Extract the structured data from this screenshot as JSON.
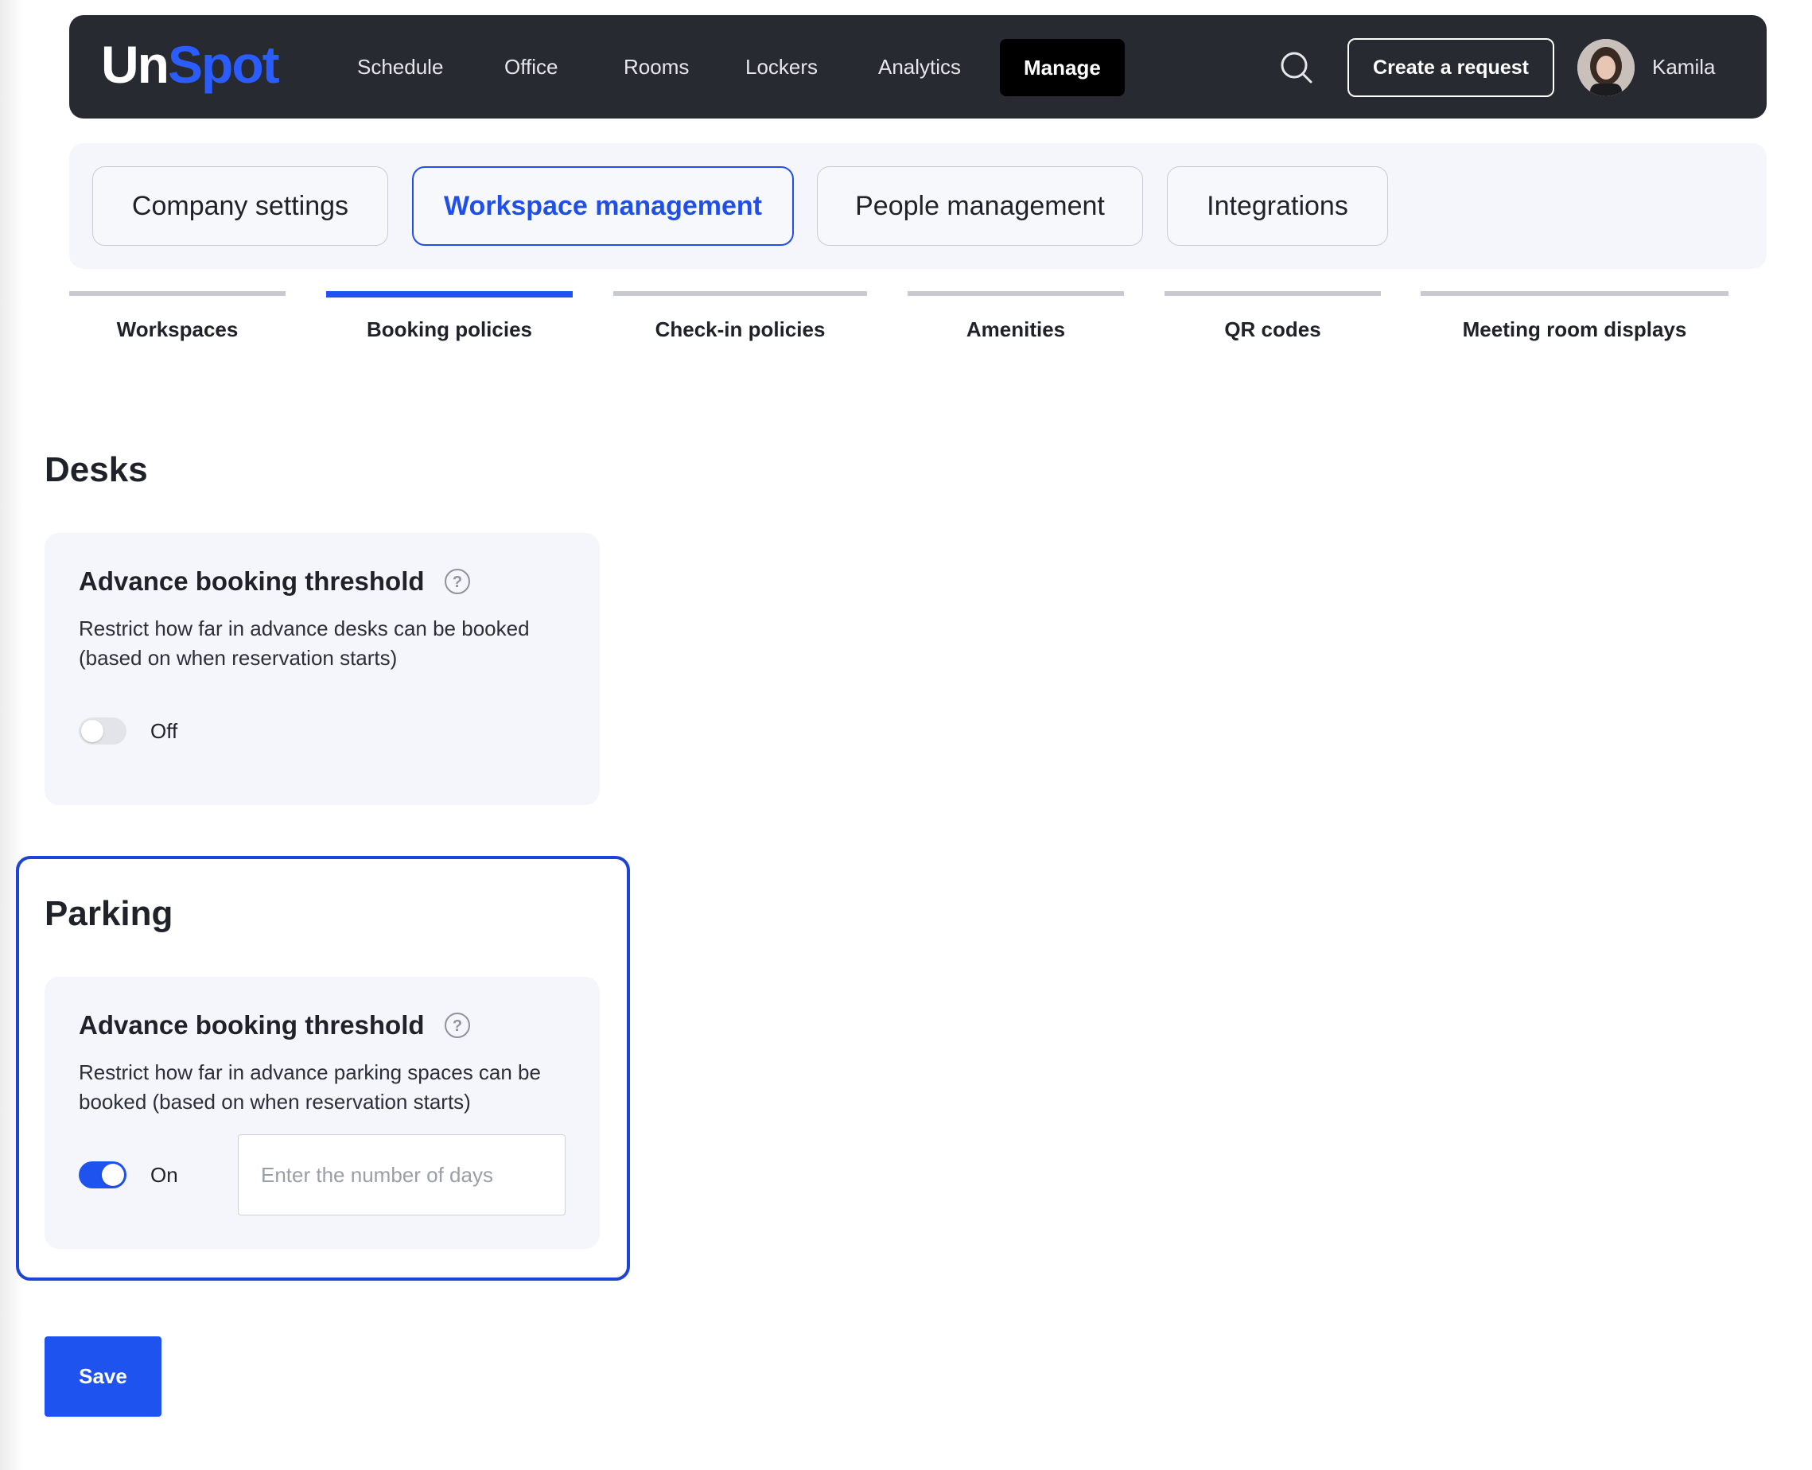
{
  "app": {
    "logo_part1": "Un",
    "logo_part2": "Spot"
  },
  "nav": {
    "items": [
      {
        "label": "Schedule"
      },
      {
        "label": "Office"
      },
      {
        "label": "Rooms"
      },
      {
        "label": "Lockers"
      },
      {
        "label": "Analytics"
      },
      {
        "label": "Manage",
        "active": true
      }
    ],
    "create_request_label": "Create a request",
    "user_name": "Kamila"
  },
  "category_tabs": [
    {
      "label": "Company settings"
    },
    {
      "label": "Workspace management",
      "active": true
    },
    {
      "label": "People management"
    },
    {
      "label": "Integrations"
    }
  ],
  "sub_tabs": [
    {
      "label": "Workspaces"
    },
    {
      "label": "Booking policies",
      "active": true
    },
    {
      "label": "Check-in policies"
    },
    {
      "label": "Amenities"
    },
    {
      "label": "QR codes"
    },
    {
      "label": "Meeting room displays"
    }
  ],
  "desks": {
    "title": "Desks",
    "card": {
      "title": "Advance booking threshold",
      "description": "Restrict how far in advance desks can be booked (based on when reservation starts)",
      "toggle_state": "Off",
      "toggle_on": false
    }
  },
  "parking": {
    "title": "Parking",
    "card": {
      "title": "Advance booking threshold",
      "description": "Restrict how far in advance parking spaces can be booked (based on when reservation starts)",
      "toggle_state": "On",
      "toggle_on": true,
      "days_input": {
        "value": "",
        "placeholder": "Enter the number of days"
      }
    }
  },
  "save_label": "Save",
  "colors": {
    "accent": "#1f53f0",
    "nav_bg": "#272a31",
    "card_bg": "#f5f6fc"
  }
}
